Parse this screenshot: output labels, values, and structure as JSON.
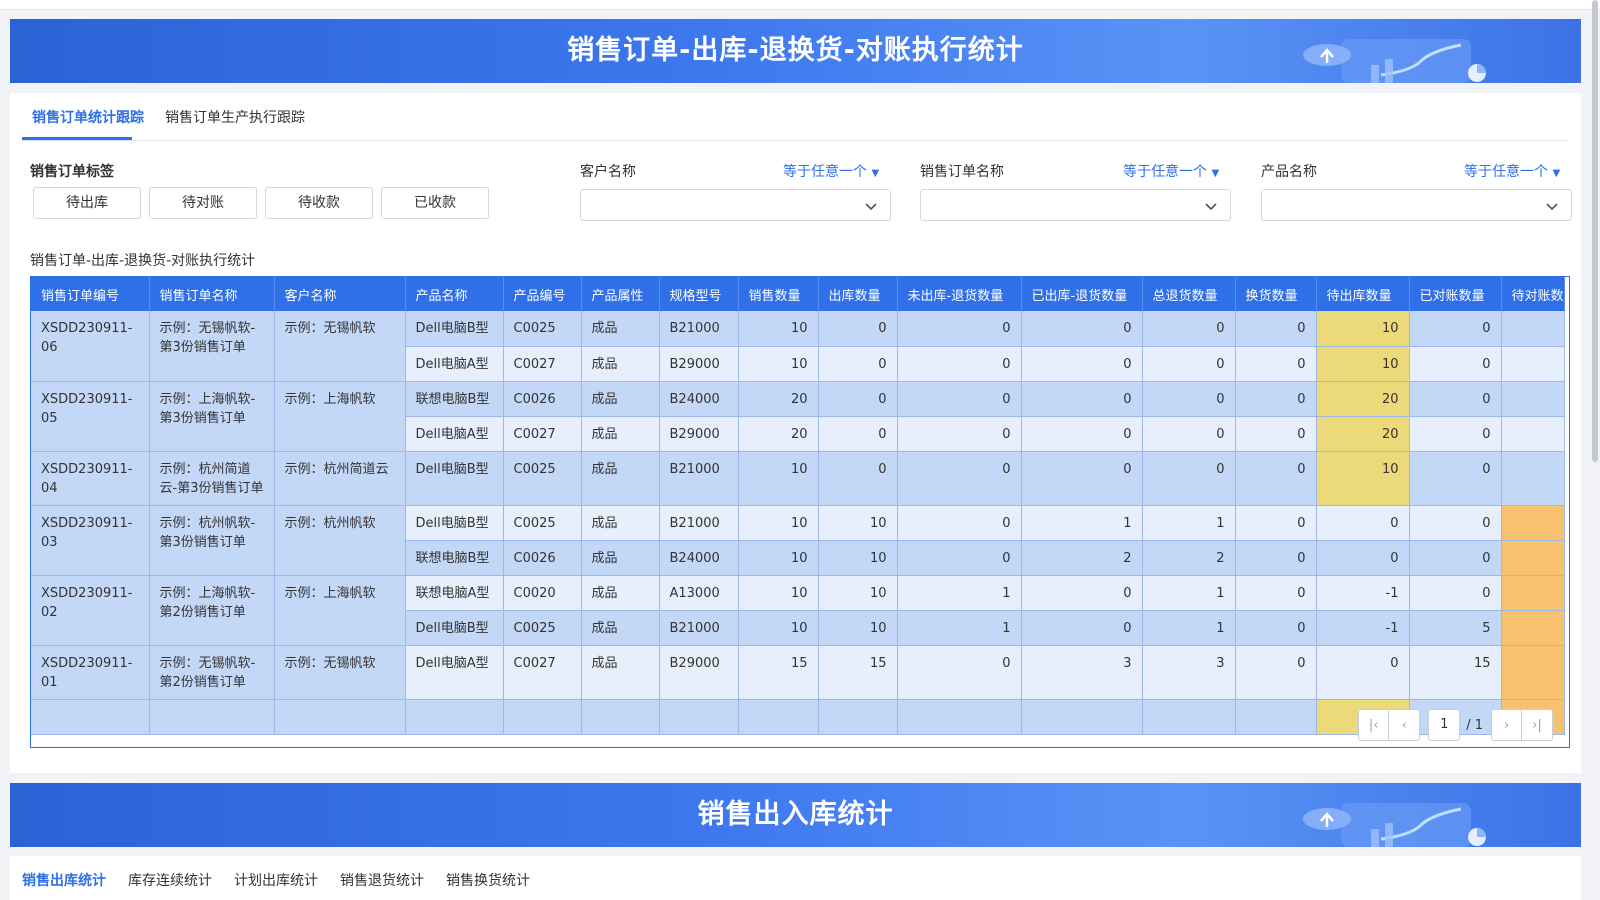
{
  "banner1": {
    "title": "销售订单-出库-退换货-对账执行统计"
  },
  "tabs": [
    {
      "label": "销售订单统计跟踪"
    },
    {
      "label": "销售订单生产执行跟踪"
    }
  ],
  "filters": {
    "tag_label": "销售订单标签",
    "tags": [
      "待出库",
      "待对账",
      "待收款",
      "已收款"
    ],
    "customer": {
      "label": "客户名称",
      "mode": "等于任意一个",
      "value": ""
    },
    "order_name": {
      "label": "销售订单名称",
      "mode": "等于任意一个",
      "value": ""
    },
    "product": {
      "label": "产品名称",
      "mode": "等于任意一个",
      "value": ""
    }
  },
  "table_title": "销售订单-出库-退换货-对账执行统计",
  "table": {
    "columns": [
      "销售订单编号",
      "销售订单名称",
      "客户名称",
      "产品名称",
      "产品编号",
      "产品属性",
      "规格型号",
      "销售数量",
      "出库数量",
      "未出库-退货数量",
      "已出库-退货数量",
      "总退货数量",
      "换货数量",
      "待出库数量",
      "已对账数量",
      "待对账数量"
    ],
    "groups": [
      {
        "order_no": "XSDD230911-06",
        "order_name": "示例：无锡帆软-第3份销售订单",
        "customer": "示例：无锡帆软",
        "rows": [
          {
            "product": "Dell电脑B型",
            "code": "C0025",
            "attr": "成品",
            "spec": "B21000",
            "sales": "10",
            "out": "0",
            "unout_ret": "0",
            "out_ret": "0",
            "total_ret": "0",
            "exchange": "0",
            "pending_out": "10",
            "reconciled": "0",
            "pending_rec": ""
          },
          {
            "product": "Dell电脑A型",
            "code": "C0027",
            "attr": "成品",
            "spec": "B29000",
            "sales": "10",
            "out": "0",
            "unout_ret": "0",
            "out_ret": "0",
            "total_ret": "0",
            "exchange": "0",
            "pending_out": "10",
            "reconciled": "0",
            "pending_rec": ""
          }
        ]
      },
      {
        "order_no": "XSDD230911-05",
        "order_name": "示例：上海帆软-第3份销售订单",
        "customer": "示例：上海帆软",
        "rows": [
          {
            "product": "联想电脑B型",
            "code": "C0026",
            "attr": "成品",
            "spec": "B24000",
            "sales": "20",
            "out": "0",
            "unout_ret": "0",
            "out_ret": "0",
            "total_ret": "0",
            "exchange": "0",
            "pending_out": "20",
            "reconciled": "0",
            "pending_rec": ""
          },
          {
            "product": "Dell电脑A型",
            "code": "C0027",
            "attr": "成品",
            "spec": "B29000",
            "sales": "20",
            "out": "0",
            "unout_ret": "0",
            "out_ret": "0",
            "total_ret": "0",
            "exchange": "0",
            "pending_out": "20",
            "reconciled": "0",
            "pending_rec": ""
          }
        ]
      },
      {
        "order_no": "XSDD230911-04",
        "order_name": "示例：杭州简道云-第3份销售订单",
        "customer": "示例：杭州简道云",
        "rows": [
          {
            "product": "Dell电脑B型",
            "code": "C0025",
            "attr": "成品",
            "spec": "B21000",
            "sales": "10",
            "out": "0",
            "unout_ret": "0",
            "out_ret": "0",
            "total_ret": "0",
            "exchange": "0",
            "pending_out": "10",
            "reconciled": "0",
            "pending_rec": ""
          }
        ]
      },
      {
        "order_no": "XSDD230911-03",
        "order_name": "示例：杭州帆软-第3份销售订单",
        "customer": "示例：杭州帆软",
        "rows": [
          {
            "product": "Dell电脑B型",
            "code": "C0025",
            "attr": "成品",
            "spec": "B21000",
            "sales": "10",
            "out": "10",
            "unout_ret": "0",
            "out_ret": "1",
            "total_ret": "1",
            "exchange": "0",
            "pending_out": "0",
            "reconciled": "0",
            "pending_rec": ""
          },
          {
            "product": "联想电脑B型",
            "code": "C0026",
            "attr": "成品",
            "spec": "B24000",
            "sales": "10",
            "out": "10",
            "unout_ret": "0",
            "out_ret": "2",
            "total_ret": "2",
            "exchange": "0",
            "pending_out": "0",
            "reconciled": "0",
            "pending_rec": ""
          }
        ]
      },
      {
        "order_no": "XSDD230911-02",
        "order_name": "示例：上海帆软-第2份销售订单",
        "customer": "示例：上海帆软",
        "rows": [
          {
            "product": "联想电脑A型",
            "code": "C0020",
            "attr": "成品",
            "spec": "A13000",
            "sales": "10",
            "out": "10",
            "unout_ret": "1",
            "out_ret": "0",
            "total_ret": "1",
            "exchange": "0",
            "pending_out": "-1",
            "reconciled": "0",
            "pending_rec": ""
          },
          {
            "product": "Dell电脑B型",
            "code": "C0025",
            "attr": "成品",
            "spec": "B21000",
            "sales": "10",
            "out": "10",
            "unout_ret": "1",
            "out_ret": "0",
            "total_ret": "1",
            "exchange": "0",
            "pending_out": "-1",
            "reconciled": "5",
            "pending_rec": ""
          }
        ]
      },
      {
        "order_no": "XSDD230911-01",
        "order_name": "示例：无锡帆软-第2份销售订单",
        "customer": "示例：无锡帆软",
        "rows": [
          {
            "product": "Dell电脑A型",
            "code": "C0027",
            "attr": "成品",
            "spec": "B29000",
            "sales": "15",
            "out": "15",
            "unout_ret": "0",
            "out_ret": "3",
            "total_ret": "3",
            "exchange": "0",
            "pending_out": "0",
            "reconciled": "15",
            "pending_rec": ""
          }
        ]
      }
    ]
  },
  "pagination": {
    "current": "1",
    "total": "/ 1"
  },
  "banner2": {
    "title": "销售出入库统计"
  },
  "tabs2": [
    {
      "label": "销售出库统计"
    },
    {
      "label": "库存连续统计"
    },
    {
      "label": "计划出库统计"
    },
    {
      "label": "销售退货统计"
    },
    {
      "label": "销售换货统计"
    }
  ],
  "colors": {
    "accent": "#2f6fe8",
    "row_odd": "#c3d7f7",
    "row_even": "#e7effc",
    "highlight_yellow": "#ecd97a",
    "highlight_orange": "#f6c26e"
  }
}
